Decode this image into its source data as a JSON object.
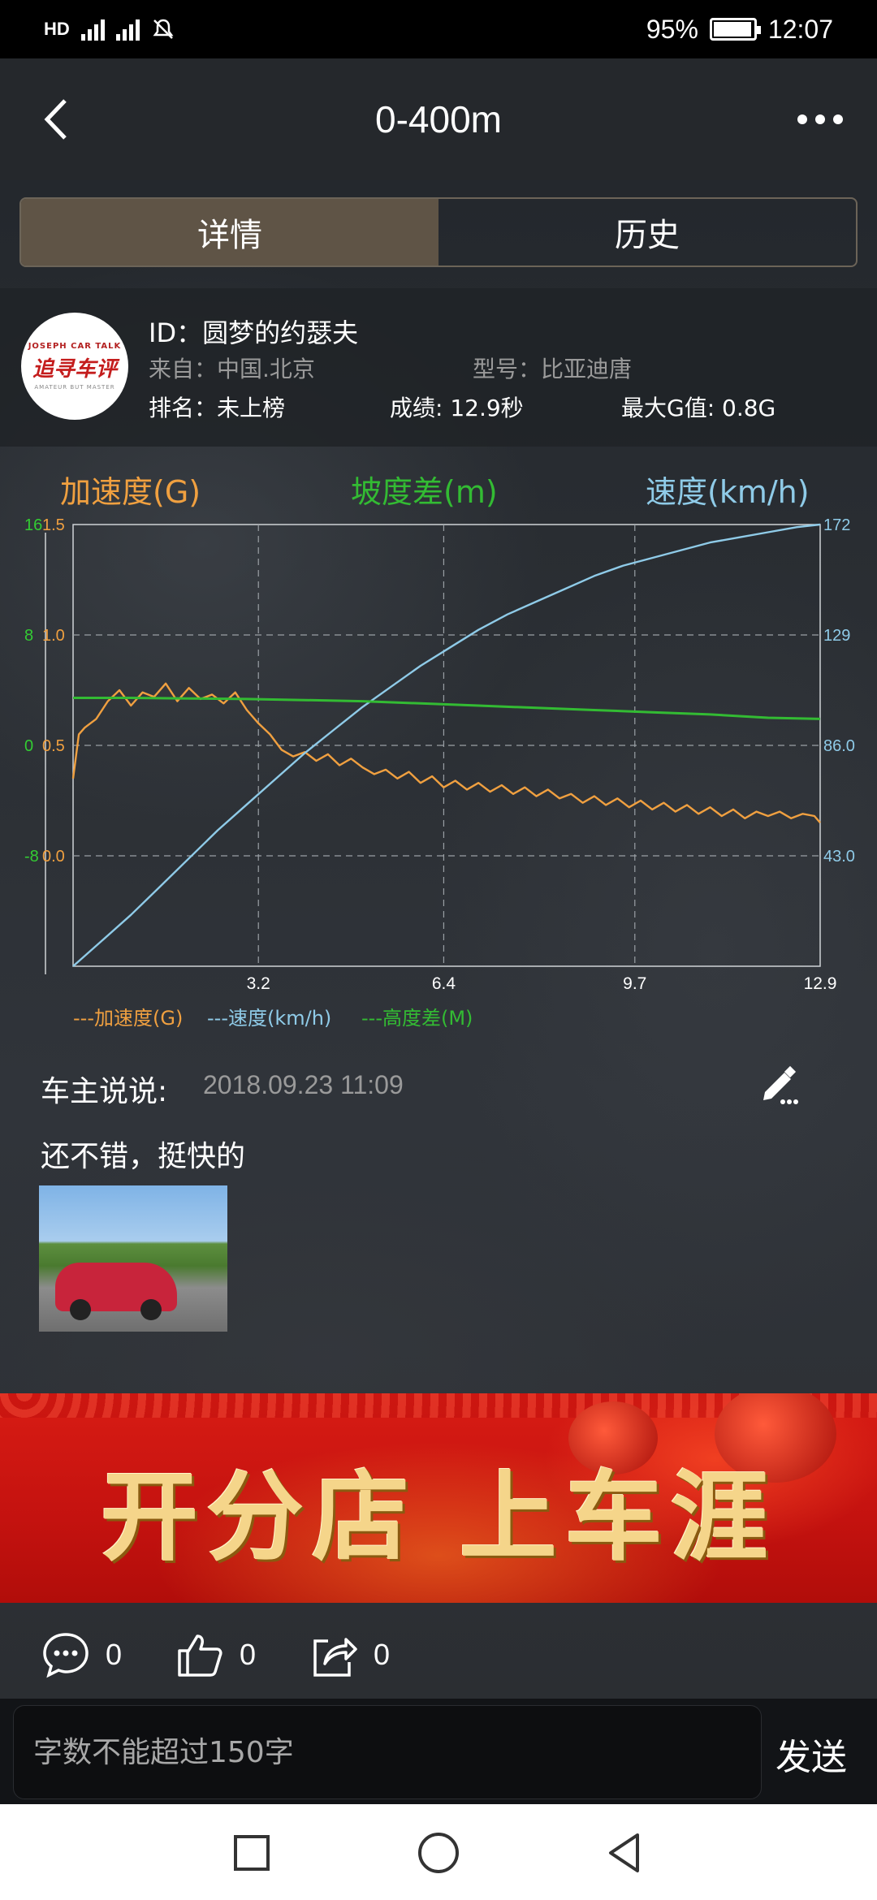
{
  "status_bar": {
    "left_icons": [
      "hd-icon",
      "signal-4g-icon",
      "signal-4g-icon",
      "mute-icon"
    ],
    "battery_percent": "95%",
    "battery_level": 0.95,
    "time": "12:07"
  },
  "nav": {
    "title": "0-400m"
  },
  "tabs": [
    {
      "label": "详情",
      "active": true
    },
    {
      "label": "历史",
      "active": false
    }
  ],
  "profile": {
    "avatar_logo_top": "JOSEPH CAR TALK",
    "avatar_logo_main": "追寻车评",
    "avatar_logo_sub": "AMATEUR BUT MASTER",
    "id_text": "ID：圆梦的约瑟夫",
    "from_text": "来自：中国.北京",
    "model_text": "型号：比亚迪唐",
    "rank_text": "排名：未上榜",
    "score_text": "成绩: 12.9秒",
    "maxg_text": "最大G值: 0.8G"
  },
  "chart_headers": {
    "accel": "加速度(G)",
    "slope": "坡度差(m)",
    "speed": "速度(km/h)"
  },
  "chart_data": {
    "type": "line",
    "x_ticks": [
      "3.2",
      "6.4",
      "9.7",
      "12.9"
    ],
    "xlim": [
      0,
      12.9
    ],
    "left_ticks_slope": [
      "16",
      "8",
      "0",
      "-8"
    ],
    "left_ticks_accel": [
      "1.5",
      "1.0",
      "0.5",
      "0.0"
    ],
    "right_ticks_speed": [
      "172",
      "129",
      "86.0",
      "43.0"
    ],
    "accel_ylim": [
      -0.5,
      1.5
    ],
    "speed_ylim": [
      0,
      172
    ],
    "slope_ylim": [
      -24,
      16
    ],
    "grid": true,
    "legend": "bottom",
    "legend_items": [
      {
        "label": "---加速度(G)",
        "color": "#f0a040"
      },
      {
        "label": "---速度(km/h)",
        "color": "#8fcbe8"
      },
      {
        "label": "---高度差(M)",
        "color": "#33bb33"
      }
    ],
    "series": [
      {
        "name": "加速度(G)",
        "color": "#f0a040",
        "x": [
          0,
          0.1,
          0.2,
          0.4,
          0.6,
          0.8,
          1.0,
          1.2,
          1.4,
          1.6,
          1.8,
          2.0,
          2.2,
          2.4,
          2.6,
          2.8,
          3.0,
          3.2,
          3.4,
          3.6,
          3.8,
          4.0,
          4.2,
          4.4,
          4.6,
          4.8,
          5.0,
          5.2,
          5.4,
          5.6,
          5.8,
          6.0,
          6.2,
          6.4,
          6.6,
          6.8,
          7.0,
          7.2,
          7.4,
          7.6,
          7.8,
          8.0,
          8.2,
          8.4,
          8.6,
          8.8,
          9.0,
          9.2,
          9.4,
          9.6,
          9.8,
          10.0,
          10.2,
          10.4,
          10.6,
          10.8,
          11.0,
          11.2,
          11.4,
          11.6,
          11.8,
          12.0,
          12.2,
          12.4,
          12.6,
          12.8,
          12.9
        ],
        "values": [
          0.35,
          0.55,
          0.58,
          0.62,
          0.7,
          0.75,
          0.68,
          0.74,
          0.72,
          0.78,
          0.7,
          0.76,
          0.71,
          0.73,
          0.69,
          0.74,
          0.66,
          0.6,
          0.55,
          0.48,
          0.45,
          0.47,
          0.43,
          0.46,
          0.41,
          0.44,
          0.4,
          0.37,
          0.39,
          0.35,
          0.38,
          0.33,
          0.36,
          0.31,
          0.34,
          0.3,
          0.33,
          0.29,
          0.32,
          0.28,
          0.31,
          0.27,
          0.3,
          0.26,
          0.28,
          0.24,
          0.27,
          0.23,
          0.26,
          0.22,
          0.25,
          0.21,
          0.24,
          0.2,
          0.23,
          0.19,
          0.22,
          0.18,
          0.21,
          0.17,
          0.2,
          0.18,
          0.2,
          0.17,
          0.19,
          0.18,
          0.15
        ]
      },
      {
        "name": "速度(km/h)",
        "color": "#8fcbe8",
        "x": [
          0,
          0.5,
          1.0,
          1.5,
          2.0,
          2.5,
          3.0,
          3.5,
          4.0,
          4.5,
          5.0,
          5.5,
          6.0,
          6.5,
          7.0,
          7.5,
          8.0,
          8.5,
          9.0,
          9.5,
          10.0,
          10.5,
          11.0,
          11.5,
          12.0,
          12.5,
          12.9
        ],
        "values": [
          0,
          10,
          20,
          31,
          42,
          53,
          63,
          73,
          83,
          92,
          101,
          109,
          117,
          124,
          131,
          137,
          142,
          147,
          152,
          156,
          159,
          162,
          165,
          167,
          169,
          171,
          172
        ]
      },
      {
        "name": "高度差(M)",
        "color": "#33bb33",
        "x": [
          0,
          1,
          2,
          3,
          4,
          5,
          6,
          7,
          8,
          9,
          10,
          11,
          12,
          12.9
        ],
        "values": [
          0.3,
          0.3,
          0.25,
          0.2,
          0.1,
          0,
          -0.2,
          -0.4,
          -0.6,
          -0.8,
          -1.0,
          -1.2,
          -1.5,
          -1.6
        ]
      }
    ]
  },
  "owner_comment": {
    "label": "车主说说:",
    "date": "2018.09.23 11:09",
    "text": "还不错，挺快的"
  },
  "banner": {
    "text": "开分店 上车涯"
  },
  "actions": {
    "comments_count": "0",
    "likes_count": "0",
    "shares_count": "0"
  },
  "input": {
    "placeholder": "字数不能超过150字",
    "send_label": "发送"
  }
}
